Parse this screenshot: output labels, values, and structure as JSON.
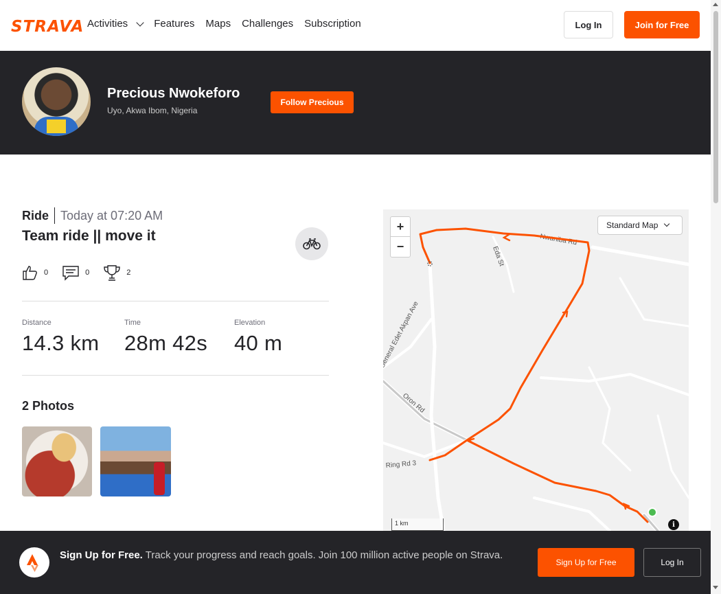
{
  "nav": {
    "logo": "STRAVA",
    "links": [
      "Activities",
      "Features",
      "Maps",
      "Challenges",
      "Subscription"
    ],
    "login_label": "Log In",
    "join_label": "Join for Free"
  },
  "athlete": {
    "name": "Precious Nwokeforo",
    "location": "Uyo, Akwa Ibom, Nigeria",
    "follow_label": "Follow Precious"
  },
  "activity": {
    "type": "Ride",
    "time": "Today at 07:20 AM",
    "title": "Team ride || move it",
    "kudos": "0",
    "comments": "0",
    "achievements": "2",
    "stats": [
      {
        "label": "Distance",
        "value": "14.3 km"
      },
      {
        "label": "Time",
        "value": "28m 42s"
      },
      {
        "label": "Elevation",
        "value": "40 m"
      }
    ],
    "photos_heading": "2 Photos"
  },
  "map": {
    "zoom_in": "+",
    "zoom_out": "−",
    "style_select": "Standard Map",
    "scale": "1 km",
    "info": "i",
    "street_labels": [
      "Nwaniba Rd",
      "Eda St",
      "General Edet Akpan Ave",
      "Oron Rd",
      "Ring Rd 3"
    ],
    "route_color": "#fc5200",
    "start_color": "#4cbb51"
  },
  "banner": {
    "bold": "Sign Up for Free.",
    "text": " Track your progress and reach goals. Join 100 million active people on Strava.",
    "signup_label": "Sign Up for Free",
    "login_label": "Log In"
  },
  "colors": {
    "brand": "#fc5200",
    "dark": "#242428"
  }
}
